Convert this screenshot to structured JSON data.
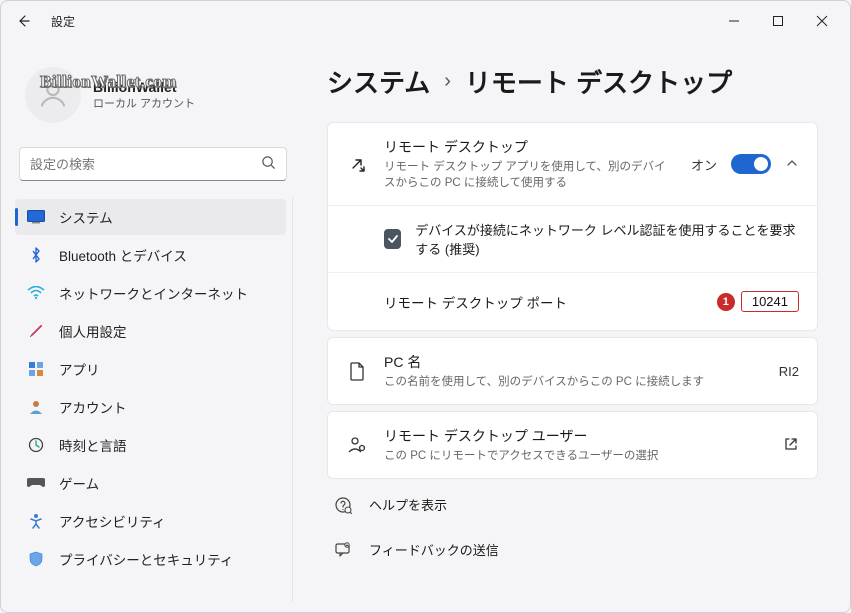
{
  "titlebar": {
    "title": "設定"
  },
  "profile": {
    "name": "BillionWallet",
    "sub": "ローカル アカウント",
    "watermark": "BillionWallet.com"
  },
  "search": {
    "placeholder": "設定の検索"
  },
  "sidebar": {
    "items": [
      {
        "label": "システム"
      },
      {
        "label": "Bluetooth とデバイス"
      },
      {
        "label": "ネットワークとインターネット"
      },
      {
        "label": "個人用設定"
      },
      {
        "label": "アプリ"
      },
      {
        "label": "アカウント"
      },
      {
        "label": "時刻と言語"
      },
      {
        "label": "ゲーム"
      },
      {
        "label": "アクセシビリティ"
      },
      {
        "label": "プライバシーとセキュリティ"
      }
    ]
  },
  "breadcrumb": {
    "parent": "システム",
    "sep": "›",
    "current": "リモート デスクトップ"
  },
  "remote": {
    "title": "リモート デスクトップ",
    "desc": "リモート デスクトップ アプリを使用して、別のデバイスからこの PC に接続して使用する",
    "state": "オン",
    "nla_label": "デバイスが接続にネットワーク レベル認証を使用することを要求する (推奨)",
    "port_label": "リモート デスクトップ ポート",
    "port_value": "10241",
    "port_badge": "1"
  },
  "pcname": {
    "title": "PC 名",
    "desc": "この名前を使用して、別のデバイスからこの PC に接続します",
    "value": "RI2"
  },
  "users": {
    "title": "リモート デスクトップ ユーザー",
    "desc": "この PC にリモートでアクセスできるユーザーの選択"
  },
  "footer": {
    "help": "ヘルプを表示",
    "feedback": "フィードバックの送信"
  }
}
